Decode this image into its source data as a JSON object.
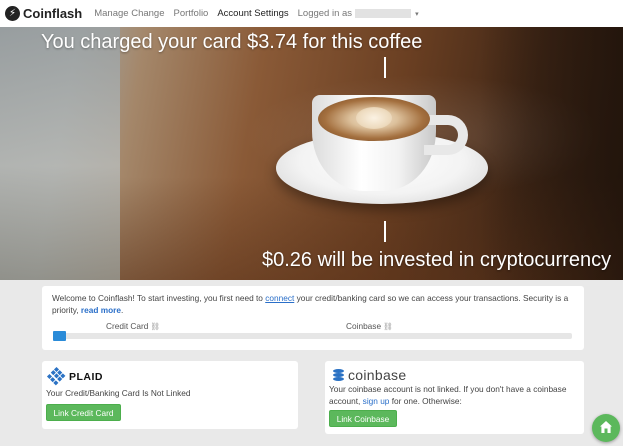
{
  "navbar": {
    "brand_icon": "⚡",
    "brand_name": "Coinflash",
    "links": [
      {
        "label": "Manage Change",
        "active": false
      },
      {
        "label": "Portfolio",
        "active": false
      },
      {
        "label": "Account Settings",
        "active": true
      }
    ],
    "user_prefix": "Logged in as",
    "caret_icon": "▾"
  },
  "hero": {
    "top_text": "You charged your card $3.74 for this coffee",
    "bottom_text": "$0.26 will be invested in cryptocurrency"
  },
  "welcome": {
    "text_before_connect": "Welcome to Coinflash! To start investing, you first need to ",
    "connect_link": "connect",
    "text_after_connect": " your credit/banking card so we can access your transactions. Security is a priority, ",
    "read_more_link": "read more",
    "text_end": ".",
    "steps": [
      {
        "label": "Credit Card",
        "icon": "⛓"
      },
      {
        "label": "Coinbase",
        "icon": "⛓"
      }
    ],
    "progress_fraction": 0.025
  },
  "plaid": {
    "logo_text": "PLAID",
    "status": "Your Credit/Banking Card Is Not Linked",
    "button_label": "Link Credit Card"
  },
  "coinbase": {
    "logo_text": "coinbase",
    "text_1": "Your coinbase account is not linked. If you don't have a coinbase account, ",
    "signup_link": "sign up",
    "text_2": " for one. Otherwise:",
    "button_label": "Link Coinbase"
  },
  "colors": {
    "accent_blue": "#2a8bd8",
    "button_green": "#5cb85c",
    "link_blue": "#2a6fc9"
  },
  "icons": {
    "home_fab": "home-icon"
  }
}
